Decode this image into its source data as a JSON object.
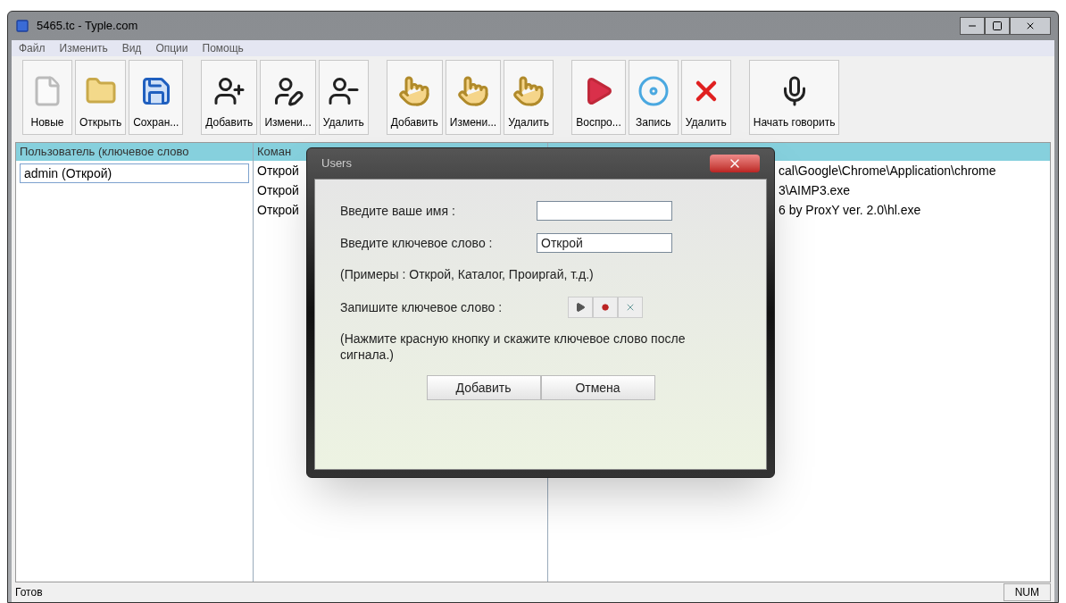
{
  "window": {
    "title": "5465.tc - Typle.com"
  },
  "menu": [
    "Файл",
    "Изменить",
    "Вид",
    "Опции",
    "Помощь"
  ],
  "toolbar": [
    [
      {
        "label": "Новые",
        "kind": "new"
      },
      {
        "label": "Открыть",
        "kind": "open"
      },
      {
        "label": "Сохран...",
        "kind": "save"
      }
    ],
    [
      {
        "label": "Добавить",
        "kind": "user-add"
      },
      {
        "label": "Измени...",
        "kind": "user-edit"
      },
      {
        "label": "Удалить",
        "kind": "user-remove"
      }
    ],
    [
      {
        "label": "Добавить",
        "kind": "hand-add"
      },
      {
        "label": "Измени...",
        "kind": "hand-edit"
      },
      {
        "label": "Удалить",
        "kind": "hand-remove"
      }
    ],
    [
      {
        "label": "Воспро...",
        "kind": "play"
      },
      {
        "label": "Запись",
        "kind": "record"
      },
      {
        "label": "Удалить",
        "kind": "delete"
      }
    ],
    [
      {
        "label": "Начать говорить",
        "kind": "speak"
      }
    ]
  ],
  "users": {
    "column": "Пользователь (ключевое слово",
    "items": [
      {
        "label": "admin (Открой)",
        "selected": true
      }
    ]
  },
  "commands": {
    "column": "Коман",
    "rows": [
      {
        "column_1": "Открой",
        "column_2": "cal\\Google\\Chrome\\Application\\chrome"
      },
      {
        "column_1": "Открой",
        "column_2": "3\\AIMP3.exe"
      },
      {
        "column_1": "Открой",
        "column_2": "6 by ProxY ver. 2.0\\hl.exe"
      }
    ]
  },
  "dialog": {
    "title": "Users",
    "name_label": "Введите ваше имя :",
    "keyword_label": "Введите ключевое слово :",
    "keyword_value": "Открой",
    "examples": "(Примеры : Открой, Каталог, Проиргай, т.д.)",
    "record_label": "Запишите ключевое слово :",
    "hint": "(Нажмите красную кнопку и скажите ключевое слово после сигнала.)",
    "buttons": [
      "Добавить",
      "Отмена"
    ]
  },
  "status_bar": {
    "text": "Готов",
    "indicators": [
      "NUM"
    ]
  }
}
